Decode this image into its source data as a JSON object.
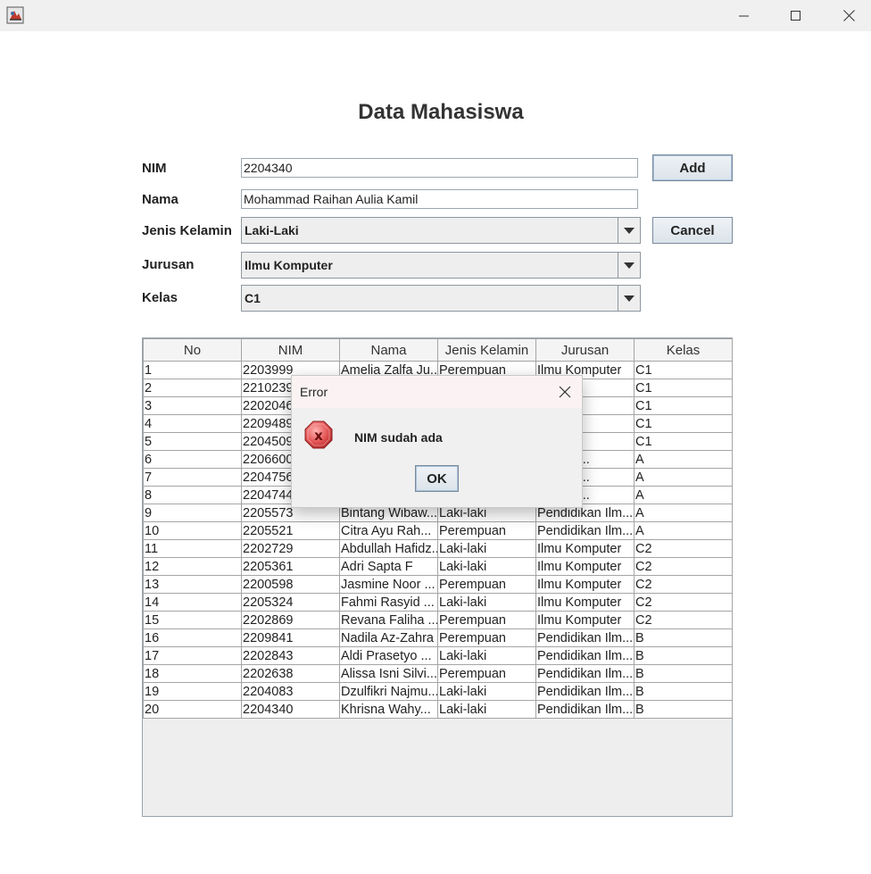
{
  "window": {
    "title": ""
  },
  "page": {
    "title": "Data Mahasiswa"
  },
  "form": {
    "nim_label": "NIM",
    "nim_value": "2204340",
    "nama_label": "Nama",
    "nama_value": "Mohammad Raihan Aulia Kamil",
    "jenis_kelamin_label": "Jenis Kelamin",
    "jenis_kelamin_value": "Laki-Laki",
    "jurusan_label": "Jurusan",
    "jurusan_value": "Ilmu Komputer",
    "kelas_label": "Kelas",
    "kelas_value": "C1",
    "add_label": "Add",
    "cancel_label": "Cancel"
  },
  "table": {
    "headers": [
      "No",
      "NIM",
      "Nama",
      "Jenis Kelamin",
      "Jurusan",
      "Kelas"
    ],
    "rows": [
      [
        "1",
        "2203999",
        "Amelia Zalfa Ju...",
        "Perempuan",
        "Ilmu Komputer",
        "C1"
      ],
      [
        "2",
        "2210239",
        "",
        "",
        "mputer",
        "C1"
      ],
      [
        "3",
        "2202046",
        "",
        "",
        "mputer",
        "C1"
      ],
      [
        "4",
        "2209489",
        "",
        "",
        "mputer",
        "C1"
      ],
      [
        "5",
        "2204509",
        "",
        "",
        "mputer",
        "C1"
      ],
      [
        "6",
        "2206600",
        "",
        "",
        "kan Ilm...",
        "A"
      ],
      [
        "7",
        "2204756",
        "",
        "",
        "kan Ilm...",
        "A"
      ],
      [
        "8",
        "2204744",
        "",
        "",
        "kan Ilm...",
        "A"
      ],
      [
        "9",
        "2205573",
        "Bintang Wibaw...",
        "Laki-laki",
        "Pendidikan Ilm...",
        "A"
      ],
      [
        "10",
        "2205521",
        "Citra Ayu Rah...",
        "Perempuan",
        "Pendidikan Ilm...",
        "A"
      ],
      [
        "11",
        "2202729",
        "Abdullah Hafidz...",
        "Laki-laki",
        "Ilmu Komputer",
        "C2"
      ],
      [
        "12",
        "2205361",
        "Adri Sapta F",
        "Laki-laki",
        "Ilmu Komputer",
        "C2"
      ],
      [
        "13",
        "2200598",
        "Jasmine Noor ...",
        "Perempuan",
        "Ilmu Komputer",
        "C2"
      ],
      [
        "14",
        "2205324",
        "Fahmi Rasyid ...",
        "Laki-laki",
        "Ilmu Komputer",
        "C2"
      ],
      [
        "15",
        "2202869",
        "Revana Faliha ...",
        "Perempuan",
        "Ilmu Komputer",
        "C2"
      ],
      [
        "16",
        "2209841",
        "Nadila Az-Zahra",
        "Perempuan",
        "Pendidikan Ilm...",
        "B"
      ],
      [
        "17",
        "2202843",
        "Aldi Prasetyo ...",
        "Laki-laki",
        "Pendidikan Ilm...",
        "B"
      ],
      [
        "18",
        "2202638",
        "Alissa Isni Silvi...",
        "Perempuan",
        "Pendidikan Ilm...",
        "B"
      ],
      [
        "19",
        "2204083",
        "Dzulfikri Najmu...",
        "Laki-laki",
        "Pendidikan Ilm...",
        "B"
      ],
      [
        "20",
        "2204340",
        "Khrisna Wahy...",
        "Laki-laki",
        "Pendidikan Ilm...",
        "B"
      ]
    ]
  },
  "dialog": {
    "title": "Error",
    "message": "NIM sudah ada",
    "ok_label": "OK",
    "icon": "error-icon"
  },
  "colors": {
    "error_red": "#d43b3b",
    "dialog_title_bg": "#fbf3f3"
  }
}
